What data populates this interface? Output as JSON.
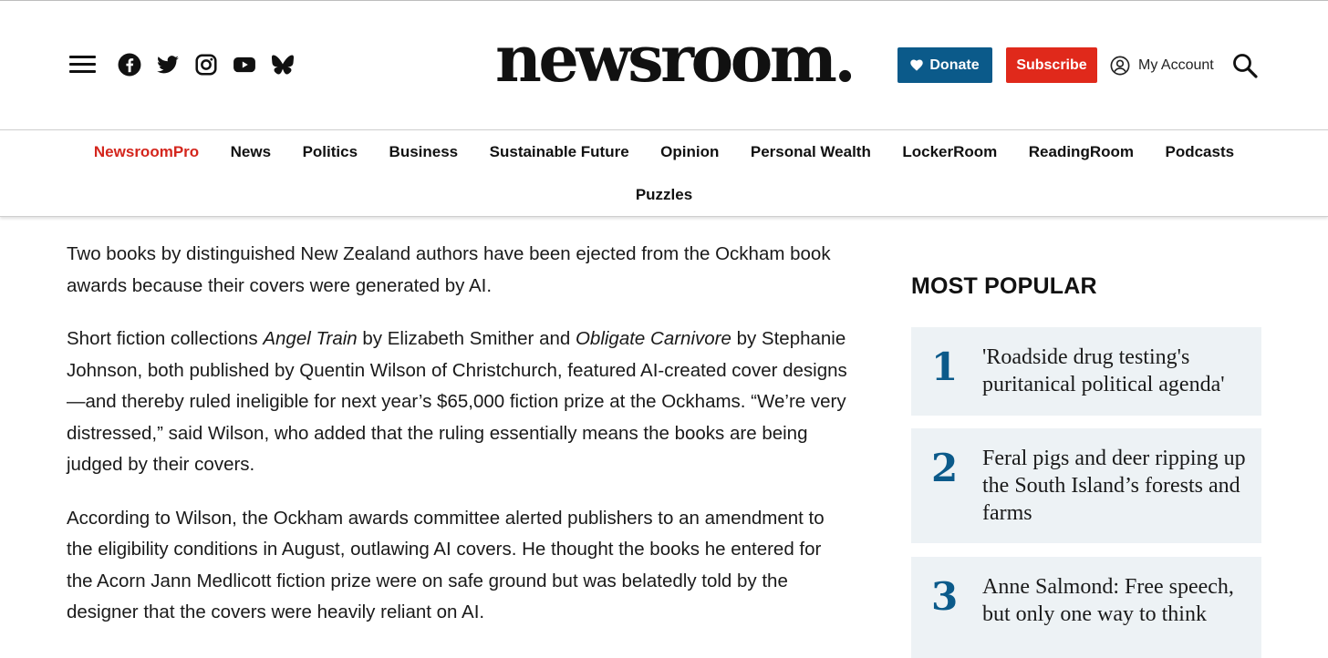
{
  "header": {
    "logo": "newsroom.",
    "donate_label": "Donate",
    "subscribe_label": "Subscribe",
    "account_label": "My Account",
    "social_icons": [
      "facebook-icon",
      "twitter-icon",
      "instagram-icon",
      "youtube-icon",
      "bluesky-icon"
    ]
  },
  "nav": {
    "items": [
      "NewsroomPro",
      "News",
      "Politics",
      "Business",
      "Sustainable Future",
      "Opinion",
      "Personal Wealth",
      "LockerRoom",
      "ReadingRoom",
      "Podcasts",
      "Puzzles"
    ]
  },
  "article": {
    "p1": "Two books by distinguished New Zealand authors have been ejected from the Ockham book awards because their covers were generated by AI.",
    "p2_a": "Short fiction collections ",
    "p2_title1": "Angel Train",
    "p2_b": " by Elizabeth Smither and ",
    "p2_title2": "Obligate Carnivore",
    "p2_c": "  by Stephanie Johnson, both published by Quentin Wilson of  Christchurch, featured AI-created cover designs—and thereby ruled ineligible for next year’s $65,000 fiction prize at the Ockhams. “We’re very distressed,” said Wilson, who added that the ruling essentially means the books are being judged by their covers.",
    "p3": "According to Wilson, the Ockham awards committee alerted publishers to an amendment to the eligibility conditions in August, outlawing AI covers. He thought the books he entered for the Acorn Jann Medlicott fiction prize were on safe ground but was belatedly told by the designer that the covers were heavily reliant on AI."
  },
  "most_popular": {
    "heading": "MOST POPULAR",
    "items": [
      {
        "num": "1",
        "title": "'Roadside drug testing's puritanical political agenda'"
      },
      {
        "num": "2",
        "title": "Feral pigs and deer ripping up the South Island’s forests and farms"
      },
      {
        "num": "3",
        "title": "Anne Salmond: Free speech, but only one way to think"
      }
    ]
  },
  "colors": {
    "accent_blue": "#0b5a8a",
    "subscribe_red": "#e0291b",
    "pro_red": "#d4261d",
    "card_bg": "#edf2f5"
  }
}
